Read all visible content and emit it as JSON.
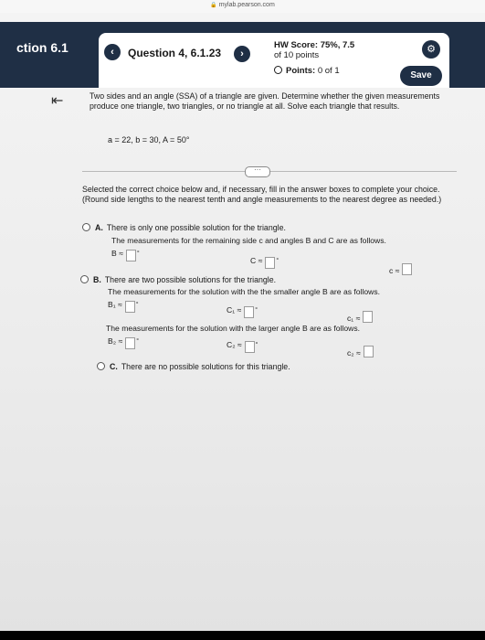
{
  "browser": {
    "url": "mylab.pearson.com"
  },
  "header": {
    "section": "ction 6.1",
    "question_label": "Question 4, 6.1.23",
    "hw_score_label": "HW Score:",
    "hw_score_value": "75%, 7.5",
    "hw_score_of": "of 10 points",
    "points_label": "Points:",
    "points_value": "0 of 1",
    "save_label": "Save"
  },
  "problem": {
    "text": "Two sides and an angle (SSA) of a triangle are given. Determine whether the given measurements produce one triangle, two triangles, or no triangle at all. Solve each triangle that results.",
    "given": "a = 22,  b = 30,  A = 50°"
  },
  "instructions": "Selected the correct choice below and, if necessary, fill in the answer boxes to complete your choice. (Round side lengths to the nearest tenth and angle measurements to the nearest degree as needed.)",
  "options": {
    "A": {
      "letter": "A.",
      "text": "There is only one possible solution for the triangle.",
      "sub": "The measurements for the remaining side c and angles B and C are as follows.",
      "b_label": "B ≈",
      "c_label": "C ≈",
      "side_label": "c ≈"
    },
    "B": {
      "letter": "B.",
      "text": "There are two possible solutions for the triangle.",
      "sub1": "The measurements for the solution with the the smaller angle B are as follows.",
      "b1_label": "B₁ ≈",
      "c1_label": "C₁ ≈",
      "side1_label": "c₁ ≈",
      "sub2": "The measurements for the solution with the larger angle B are as follows.",
      "b2_label": "B₂ ≈",
      "c2_label": "C₂ ≈",
      "side2_label": "c₂ ≈"
    },
    "C": {
      "letter": "C.",
      "text": "There are no possible solutions for this triangle."
    }
  },
  "icons": {
    "back": "back-to-start-icon",
    "prev": "chevron-left-icon",
    "next": "chevron-right-icon",
    "settings": "gear-icon"
  }
}
